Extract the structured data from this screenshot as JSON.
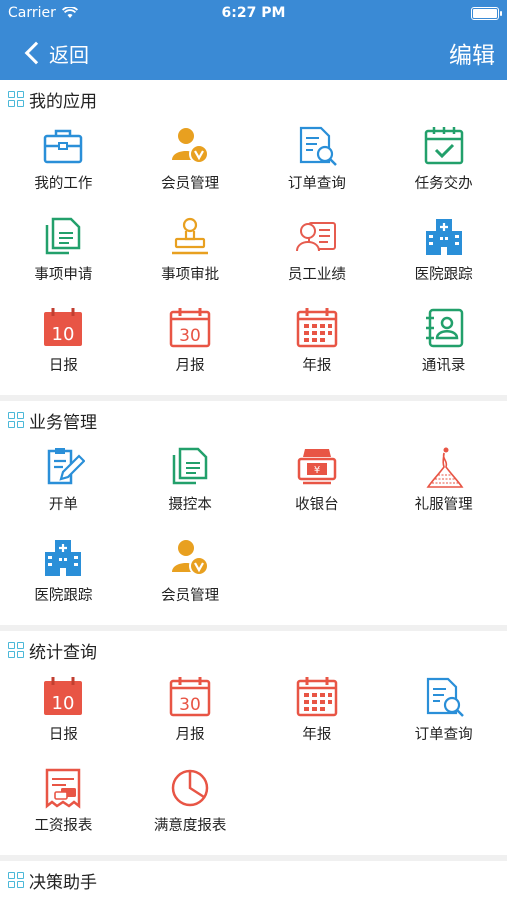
{
  "status": {
    "carrier": "Carrier",
    "time": "6:27 PM"
  },
  "nav": {
    "back_label": "返回",
    "edit_label": "编辑"
  },
  "sections": [
    {
      "title": "我的应用",
      "items": [
        {
          "label": "我的工作",
          "icon": "briefcase-icon"
        },
        {
          "label": "会员管理",
          "icon": "member-vip-icon"
        },
        {
          "label": "订单查询",
          "icon": "order-search-icon"
        },
        {
          "label": "任务交办",
          "icon": "task-calendar-check-icon"
        },
        {
          "label": "事项申请",
          "icon": "documents-icon"
        },
        {
          "label": "事项审批",
          "icon": "stamp-icon"
        },
        {
          "label": "员工业绩",
          "icon": "employee-card-icon"
        },
        {
          "label": "医院跟踪",
          "icon": "hospital-icon"
        },
        {
          "label": "日报",
          "icon": "daily-calendar-icon",
          "num": "10"
        },
        {
          "label": "月报",
          "icon": "monthly-calendar-icon",
          "num": "30"
        },
        {
          "label": "年报",
          "icon": "yearly-calendar-icon"
        },
        {
          "label": "通讯录",
          "icon": "contacts-icon"
        }
      ]
    },
    {
      "title": "业务管理",
      "items": [
        {
          "label": "开单",
          "icon": "clipboard-pen-icon"
        },
        {
          "label": "摄控本",
          "icon": "documents-icon"
        },
        {
          "label": "收银台",
          "icon": "cashier-icon"
        },
        {
          "label": "礼服管理",
          "icon": "wedding-dress-icon"
        },
        {
          "label": "医院跟踪",
          "icon": "hospital-icon"
        },
        {
          "label": "会员管理",
          "icon": "member-vip-icon"
        }
      ]
    },
    {
      "title": "统计查询",
      "items": [
        {
          "label": "日报",
          "icon": "daily-calendar-icon",
          "num": "10"
        },
        {
          "label": "月报",
          "icon": "monthly-calendar-icon",
          "num": "30"
        },
        {
          "label": "年报",
          "icon": "yearly-calendar-icon"
        },
        {
          "label": "订单查询",
          "icon": "order-search-icon"
        },
        {
          "label": "工资报表",
          "icon": "salary-report-icon"
        },
        {
          "label": "满意度报表",
          "icon": "pie-chart-icon"
        }
      ]
    },
    {
      "title": "决策助手",
      "items": []
    }
  ]
}
